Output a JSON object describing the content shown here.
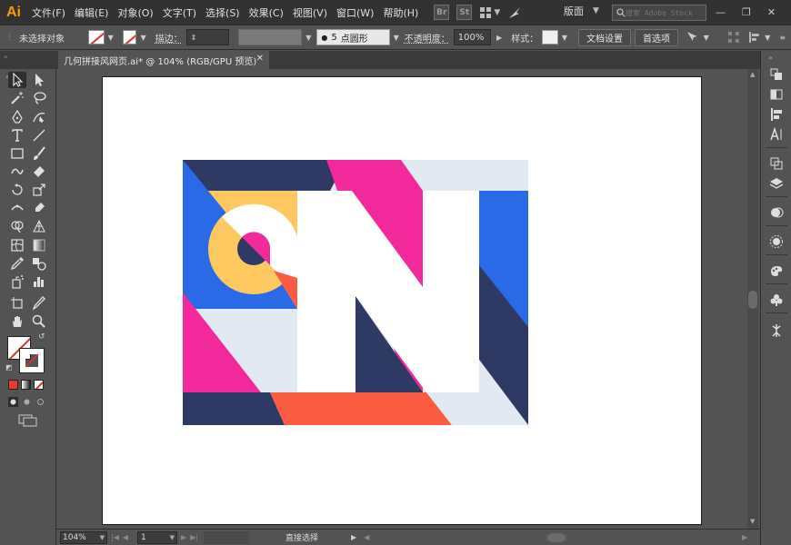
{
  "app": {
    "logo": "Ai"
  },
  "menu": [
    "文件(F)",
    "编辑(E)",
    "对象(O)",
    "文字(T)",
    "选择(S)",
    "效果(C)",
    "视图(V)",
    "窗口(W)",
    "帮助(H)"
  ],
  "app_icons": {
    "bridge": "Br",
    "stock": "St"
  },
  "workspace": {
    "label": "版面"
  },
  "search": {
    "placeholder": "搜索 Adobe Stock"
  },
  "window_controls": {
    "minimize": "—",
    "restore": "❐",
    "close": "✕"
  },
  "control": {
    "selection_label": "未选择对象",
    "stroke_label": "描边：",
    "brush_value": "5",
    "brush_label": "点圆形",
    "opacity_label": "不透明度：",
    "opacity_value": "100%",
    "style_label": "样式：",
    "doc_settings": "文档设置",
    "preferences": "首选项"
  },
  "tab": {
    "title": "几何拼接风网页.ai* @ 104% (RGB/GPU 预览)",
    "close": "✕"
  },
  "status": {
    "zoom": "104%",
    "page": "1",
    "tool": "直接选择"
  },
  "colors": {
    "navy": "#2e3a64",
    "pink": "#f1299b",
    "yellow": "#fdc85f",
    "blue": "#2b6ae6",
    "lightblue": "#e2e9f2",
    "orange": "#fa5c43",
    "white": "#ffffff"
  },
  "icons": {
    "toolbar": [
      "selection-icon",
      "direct-selection-icon",
      "magic-wand-icon",
      "lasso-icon",
      "pen-icon",
      "curvature-icon",
      "type-icon",
      "line-icon",
      "rectangle-icon",
      "paintbrush-icon",
      "shaper-icon",
      "eraser-icon",
      "rotate-icon",
      "scale-icon",
      "width-icon",
      "puppet-warp-icon",
      "shape-builder-icon",
      "perspective-icon",
      "mesh-icon",
      "gradient-icon",
      "eyedropper-icon",
      "blend-icon",
      "symbol-sprayer-icon",
      "graph-icon",
      "artboard-icon",
      "slice-icon",
      "hand-icon",
      "zoom-icon"
    ],
    "panels": [
      "properties-icon",
      "gradient-panel-icon",
      "align-icon",
      "character-icon",
      "transform-icon",
      "layers-icon",
      "appearance-icon",
      "color-icon",
      "brushes-icon",
      "symbols-icon",
      "puppet-icon"
    ]
  }
}
